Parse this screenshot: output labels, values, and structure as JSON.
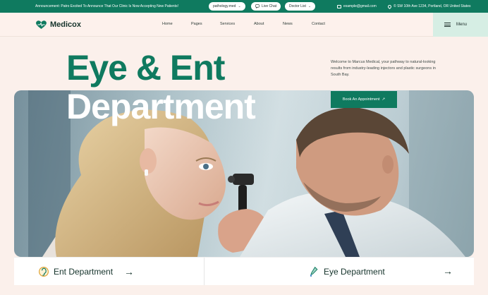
{
  "topbar": {
    "announcement": "Announcement: Patro Excited To Announce That Our Clinic Is Now Accepting New Patients!",
    "specialty_select": "pathology.med",
    "live_chat": "Live Chat",
    "doctor_list": "Doctor List",
    "email": "example@gmail.com",
    "address": "© SW 10th Ave 1234, Portland, OR United States"
  },
  "nav": {
    "logo": "Medicox",
    "links": [
      "Home",
      "Pages",
      "Services",
      "About",
      "News",
      "Contact"
    ],
    "menu_label": "Menu"
  },
  "hero": {
    "title_line1": "Eye & Ent",
    "title_line2": "Department",
    "intro": "Welcome to Marcus Medical, your pathway to natural-looking results from industry-leading injectors and plastic surgeons in South Bay.",
    "cta": "Book An Appointment",
    "cta_arrow": "↗"
  },
  "departments": [
    {
      "label": "Ent Department",
      "icon": "ear-icon",
      "arrow": "→"
    },
    {
      "label": "Eye Department",
      "icon": "eye-drop-icon",
      "arrow": "→"
    }
  ],
  "colors": {
    "brand": "#0f7a5f",
    "background": "#fbf0eb",
    "menu_bg": "#d6eee4"
  }
}
